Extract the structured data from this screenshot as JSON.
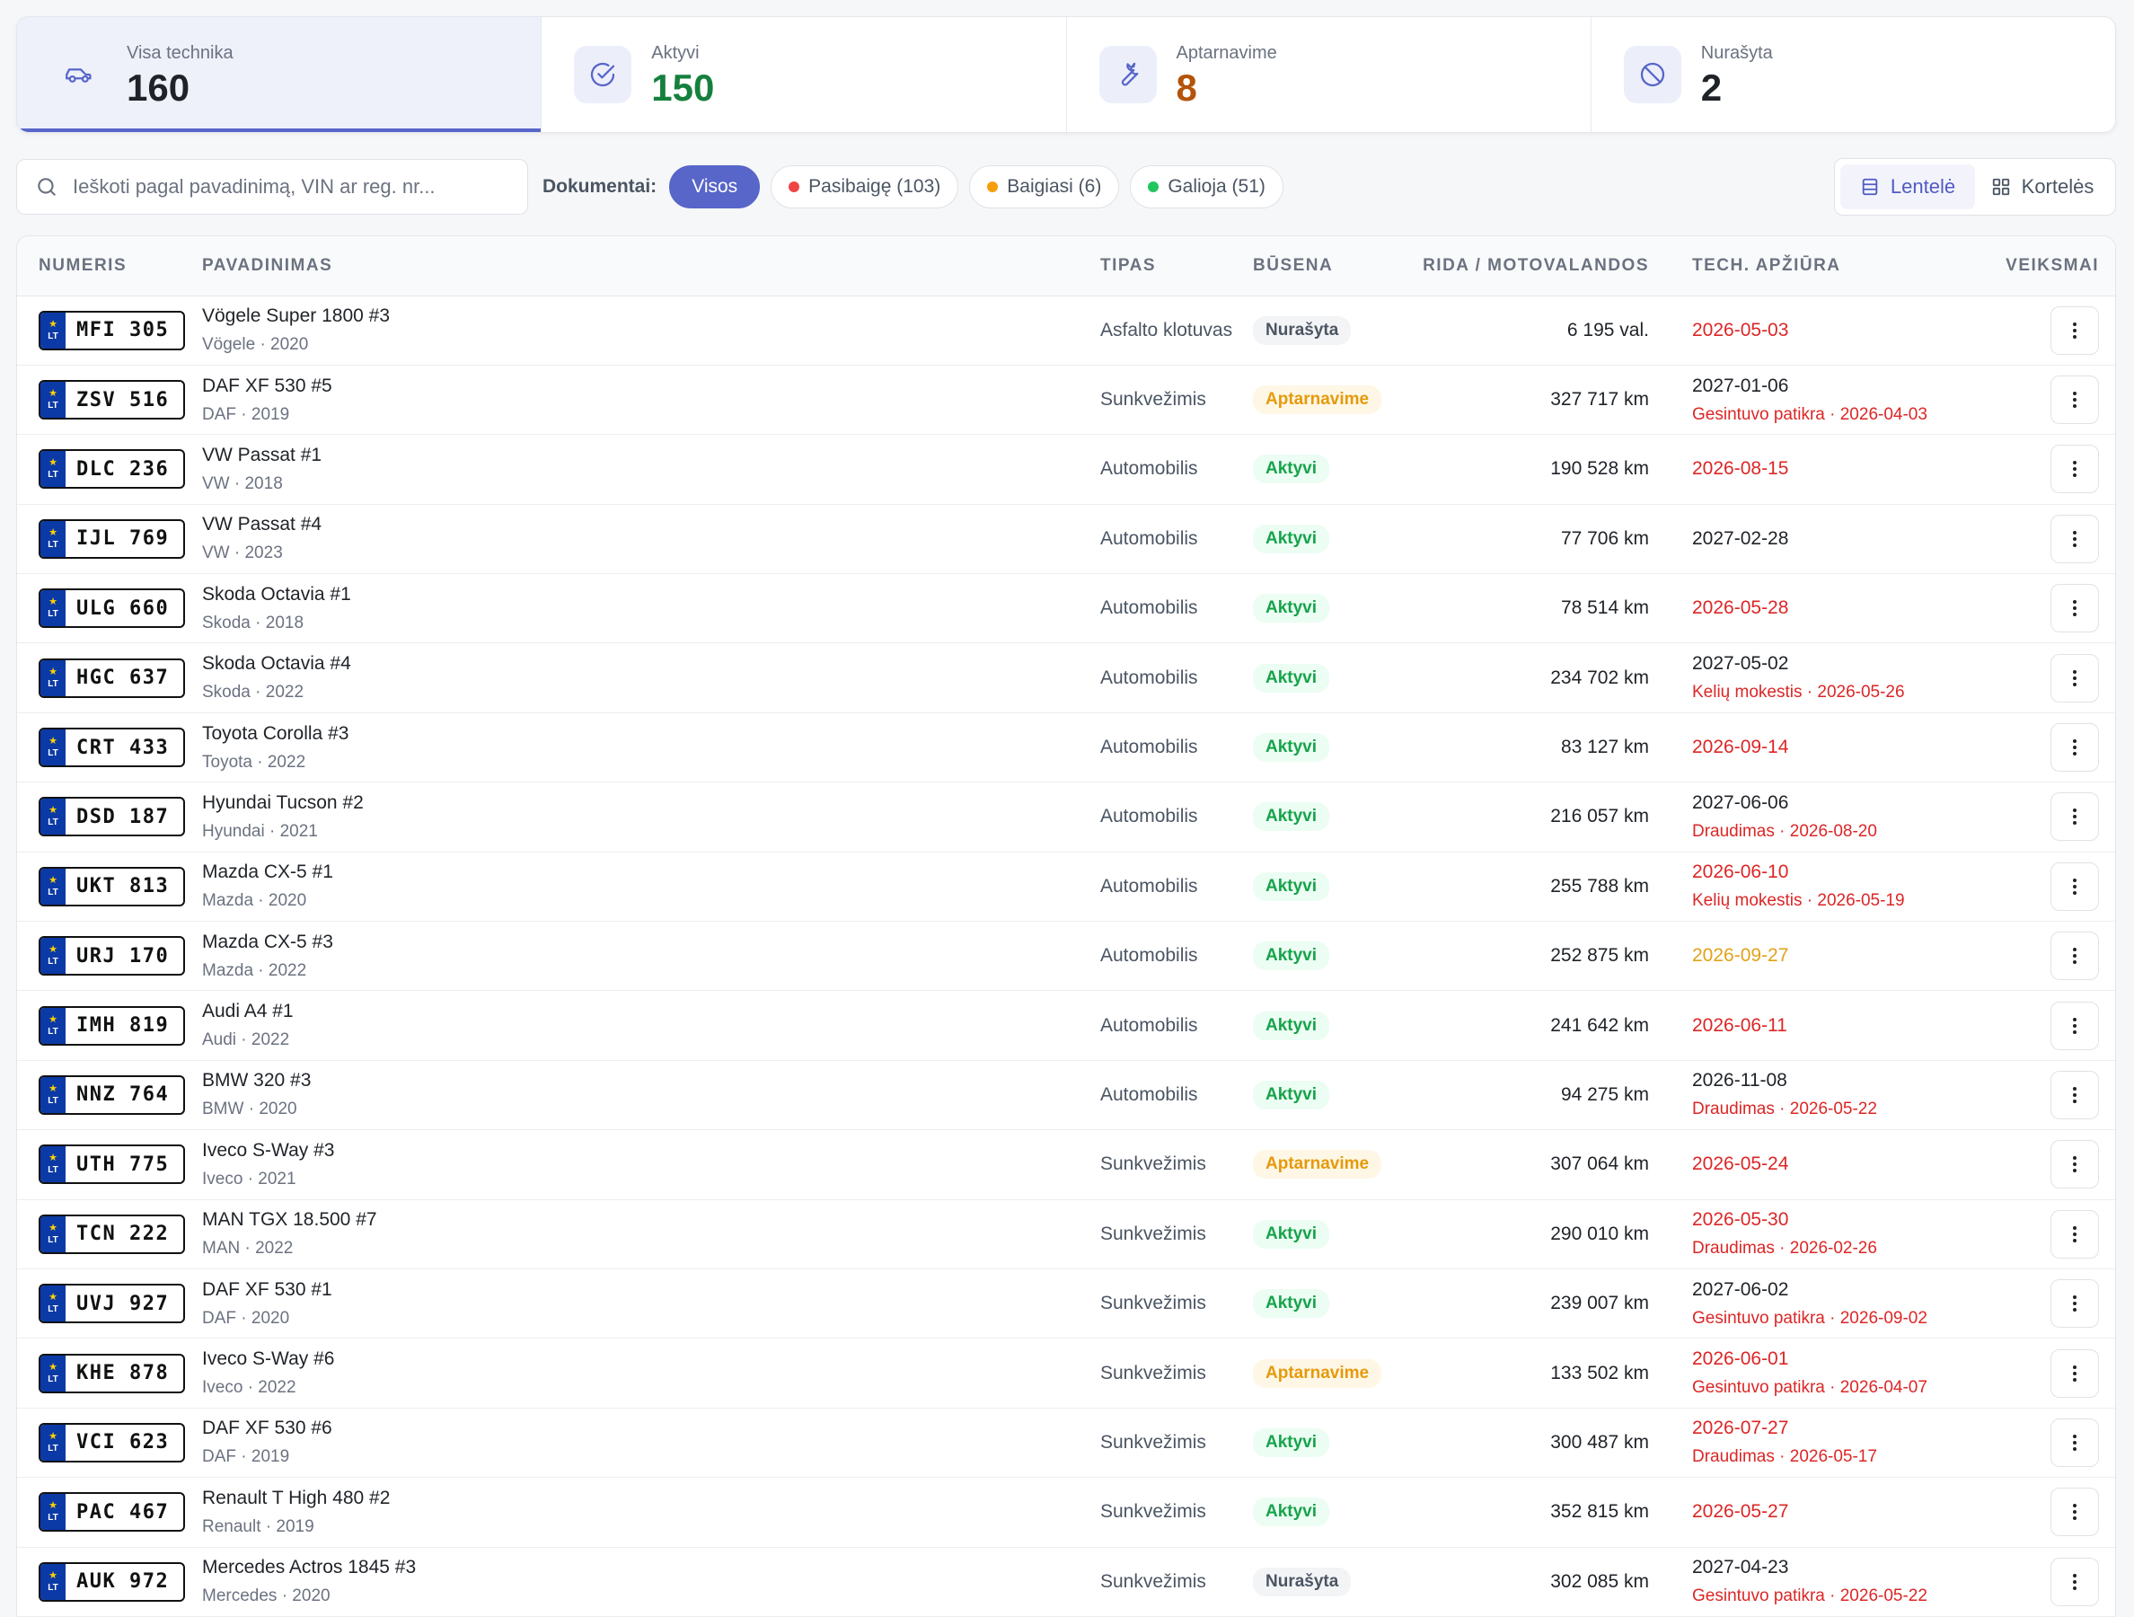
{
  "stats": [
    {
      "label": "Visa technika",
      "value": "160",
      "color": "#1f2328",
      "icon": "car-icon",
      "active": true
    },
    {
      "label": "Aktyvi",
      "value": "150",
      "color": "#15803d",
      "icon": "check-circle-icon",
      "active": false
    },
    {
      "label": "Aptarnavime",
      "value": "8",
      "color": "#b45309",
      "icon": "wrench-icon",
      "active": false
    },
    {
      "label": "Nurašyta",
      "value": "2",
      "color": "#1f2328",
      "icon": "ban-icon",
      "active": false
    }
  ],
  "search": {
    "placeholder": "Ieškoti pagal pavadinimą, VIN ar reg. nr..."
  },
  "filters": {
    "label": "Dokumentai:",
    "chips": [
      {
        "label": "Visos",
        "selected": true,
        "dot": null
      },
      {
        "label": "Pasibaigę (103)",
        "selected": false,
        "dot": "#ef4444"
      },
      {
        "label": "Baigiasi (6)",
        "selected": false,
        "dot": "#f59e0b"
      },
      {
        "label": "Galioja (51)",
        "selected": false,
        "dot": "#22c55e"
      }
    ]
  },
  "view_toggle": {
    "table_label": "Lentelė",
    "cards_label": "Kortelės",
    "selected": "table"
  },
  "table": {
    "headers": [
      "NUMERIS",
      "PAVADINIMAS",
      "TIPAS",
      "BŪSENA",
      "RIDA / MOTOVALANDOS",
      "TECH. APŽIŪRA",
      "VEIKSMAI"
    ],
    "plate_country": "LT",
    "rows": [
      {
        "plate": "MFI 305",
        "title": "Vögele Super 1800 #3",
        "sub": "Vögele · 2020",
        "type": "Asfalto klotuvas",
        "status": "Nurašyta",
        "mileage": "6 195 val.",
        "tech": "2026-05-03",
        "tech_color": "#dc2626",
        "tech_sub": ""
      },
      {
        "plate": "ZSV 516",
        "title": "DAF XF 530 #5",
        "sub": "DAF · 2019",
        "type": "Sunkvežimis",
        "status": "Aptarnavime",
        "mileage": "327 717 km",
        "tech": "2027-01-06",
        "tech_color": "#1f2328",
        "tech_sub": "Gesintuvo patikra · 2026-04-03"
      },
      {
        "plate": "DLC 236",
        "title": "VW Passat #1",
        "sub": "VW · 2018",
        "type": "Automobilis",
        "status": "Aktyvi",
        "mileage": "190 528 km",
        "tech": "2026-08-15",
        "tech_color": "#dc2626",
        "tech_sub": ""
      },
      {
        "plate": "IJL 769",
        "title": "VW Passat #4",
        "sub": "VW · 2023",
        "type": "Automobilis",
        "status": "Aktyvi",
        "mileage": "77 706 km",
        "tech": "2027-02-28",
        "tech_color": "#1f2328",
        "tech_sub": ""
      },
      {
        "plate": "ULG 660",
        "title": "Skoda Octavia #1",
        "sub": "Skoda · 2018",
        "type": "Automobilis",
        "status": "Aktyvi",
        "mileage": "78 514 km",
        "tech": "2026-05-28",
        "tech_color": "#dc2626",
        "tech_sub": ""
      },
      {
        "plate": "HGC 637",
        "title": "Skoda Octavia #4",
        "sub": "Skoda · 2022",
        "type": "Automobilis",
        "status": "Aktyvi",
        "mileage": "234 702 km",
        "tech": "2027-05-02",
        "tech_color": "#1f2328",
        "tech_sub": "Kelių mokestis · 2026-05-26"
      },
      {
        "plate": "CRT 433",
        "title": "Toyota Corolla #3",
        "sub": "Toyota · 2022",
        "type": "Automobilis",
        "status": "Aktyvi",
        "mileage": "83 127 km",
        "tech": "2026-09-14",
        "tech_color": "#dc2626",
        "tech_sub": ""
      },
      {
        "plate": "DSD 187",
        "title": "Hyundai Tucson #2",
        "sub": "Hyundai · 2021",
        "type": "Automobilis",
        "status": "Aktyvi",
        "mileage": "216 057 km",
        "tech": "2027-06-06",
        "tech_color": "#1f2328",
        "tech_sub": "Draudimas · 2026-08-20"
      },
      {
        "plate": "UKT 813",
        "title": "Mazda CX-5 #1",
        "sub": "Mazda · 2020",
        "type": "Automobilis",
        "status": "Aktyvi",
        "mileage": "255 788 km",
        "tech": "2026-06-10",
        "tech_color": "#dc2626",
        "tech_sub": "Kelių mokestis · 2026-05-19"
      },
      {
        "plate": "URJ 170",
        "title": "Mazda CX-5 #3",
        "sub": "Mazda · 2022",
        "type": "Automobilis",
        "status": "Aktyvi",
        "mileage": "252 875 km",
        "tech": "2026-09-27",
        "tech_color": "#e2a21b",
        "tech_sub": ""
      },
      {
        "plate": "IMH 819",
        "title": "Audi A4 #1",
        "sub": "Audi · 2022",
        "type": "Automobilis",
        "status": "Aktyvi",
        "mileage": "241 642 km",
        "tech": "2026-06-11",
        "tech_color": "#dc2626",
        "tech_sub": ""
      },
      {
        "plate": "NNZ 764",
        "title": "BMW 320 #3",
        "sub": "BMW · 2020",
        "type": "Automobilis",
        "status": "Aktyvi",
        "mileage": "94 275 km",
        "tech": "2026-11-08",
        "tech_color": "#1f2328",
        "tech_sub": "Draudimas · 2026-05-22"
      },
      {
        "plate": "UTH 775",
        "title": "Iveco S-Way #3",
        "sub": "Iveco · 2021",
        "type": "Sunkvežimis",
        "status": "Aptarnavime",
        "mileage": "307 064 km",
        "tech": "2026-05-24",
        "tech_color": "#dc2626",
        "tech_sub": ""
      },
      {
        "plate": "TCN 222",
        "title": "MAN TGX 18.500 #7",
        "sub": "MAN · 2022",
        "type": "Sunkvežimis",
        "status": "Aktyvi",
        "mileage": "290 010 km",
        "tech": "2026-05-30",
        "tech_color": "#dc2626",
        "tech_sub": "Draudimas · 2026-02-26"
      },
      {
        "plate": "UVJ 927",
        "title": "DAF XF 530 #1",
        "sub": "DAF · 2020",
        "type": "Sunkvežimis",
        "status": "Aktyvi",
        "mileage": "239 007 km",
        "tech": "2027-06-02",
        "tech_color": "#1f2328",
        "tech_sub": "Gesintuvo patikra · 2026-09-02"
      },
      {
        "plate": "KHE 878",
        "title": "Iveco S-Way #6",
        "sub": "Iveco · 2022",
        "type": "Sunkvežimis",
        "status": "Aptarnavime",
        "mileage": "133 502 km",
        "tech": "2026-06-01",
        "tech_color": "#dc2626",
        "tech_sub": "Gesintuvo patikra · 2026-04-07"
      },
      {
        "plate": "VCI 623",
        "title": "DAF XF 530 #6",
        "sub": "DAF · 2019",
        "type": "Sunkvežimis",
        "status": "Aktyvi",
        "mileage": "300 487 km",
        "tech": "2026-07-27",
        "tech_color": "#dc2626",
        "tech_sub": "Draudimas · 2026-05-17"
      },
      {
        "plate": "PAC 467",
        "title": "Renault T High 480 #2",
        "sub": "Renault · 2019",
        "type": "Sunkvežimis",
        "status": "Aktyvi",
        "mileage": "352 815 km",
        "tech": "2026-05-27",
        "tech_color": "#dc2626",
        "tech_sub": ""
      },
      {
        "plate": "AUK 972",
        "title": "Mercedes Actros 1845 #3",
        "sub": "Mercedes · 2020",
        "type": "Sunkvežimis",
        "status": "Nurašyta",
        "mileage": "302 085 km",
        "tech": "2027-04-23",
        "tech_color": "#1f2328",
        "tech_sub": "Gesintuvo patikra · 2026-05-22"
      }
    ]
  },
  "status_styles": {
    "Aktyvi": {
      "bg": "#ecfdf3",
      "fg": "#16a34a"
    },
    "Aptarnavime": {
      "bg": "#fff7e6",
      "fg": "#e59a0b"
    },
    "Nurašyta": {
      "bg": "#f3f4f6",
      "fg": "#4b5563"
    }
  }
}
